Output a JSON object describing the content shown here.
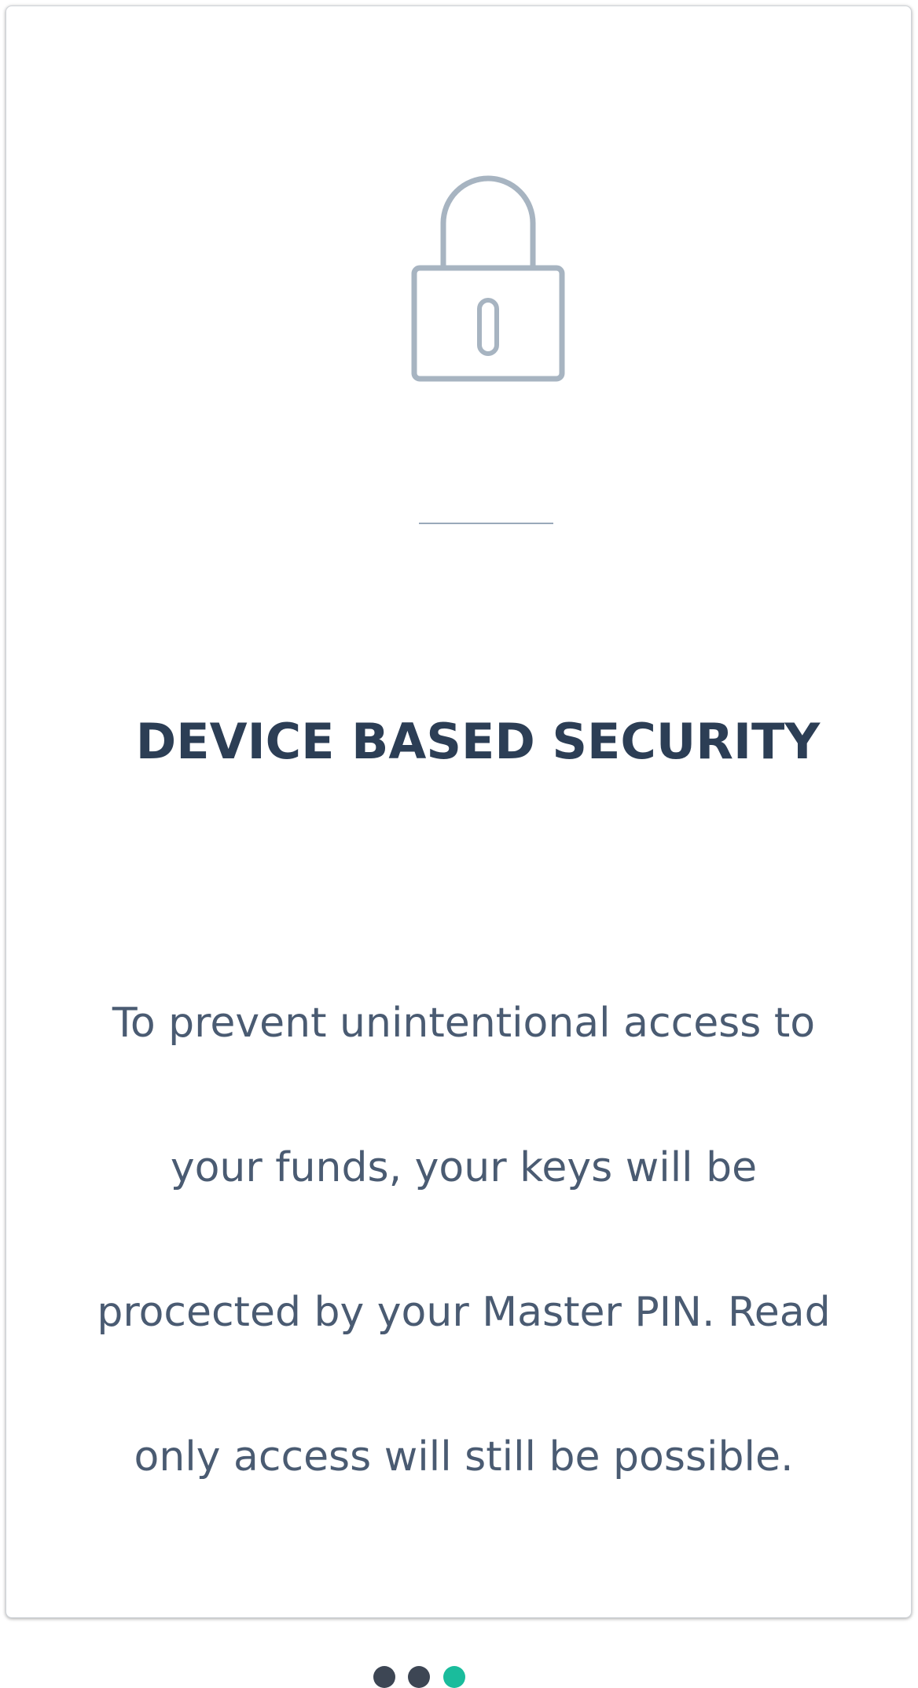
{
  "onboarding": {
    "title": "DEVICE BASED SECURITY",
    "body_lines": [
      "To prevent unintentional access to",
      "your funds, your keys will be",
      "procected by your Master PIN. Read",
      "only access will still be possible."
    ],
    "icon": "lock-icon"
  },
  "pager": {
    "total": 3,
    "current": 3,
    "active_color": "#1abc9c",
    "inactive_color": "#3d4654"
  },
  "colors": {
    "icon": "#a7b4c1",
    "title": "#2c3e55",
    "body": "#4a5b72",
    "divider": "#9aa9ba"
  }
}
